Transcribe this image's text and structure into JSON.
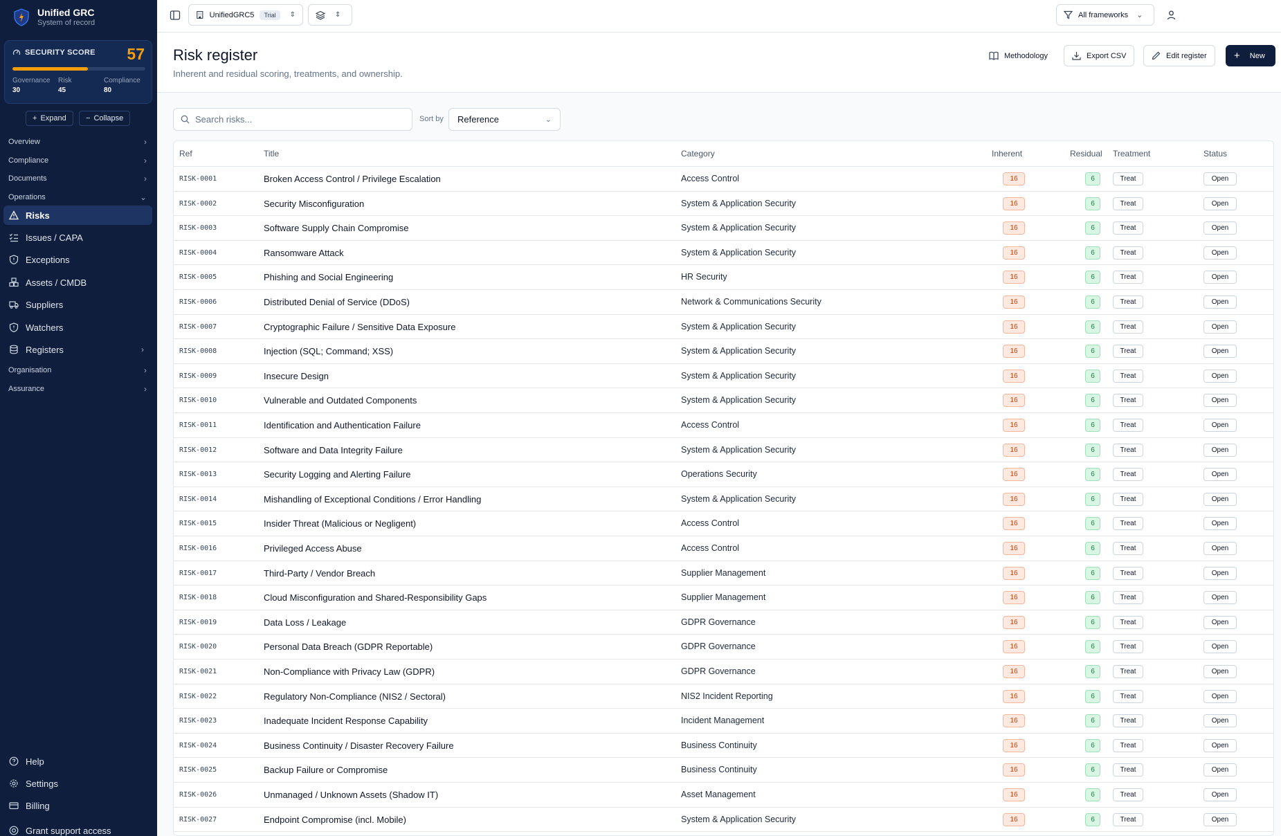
{
  "brand": {
    "name": "Unified GRC",
    "subtitle": "System of record"
  },
  "score": {
    "label": "SECURITY SCORE",
    "value": "57",
    "fill": 0.57,
    "metrics": [
      {
        "label": "Governance",
        "value": "30"
      },
      {
        "label": "Risk",
        "value": "45"
      },
      {
        "label": "Compliance",
        "value": "80"
      }
    ]
  },
  "tree_controls": {
    "expand": "Expand",
    "collapse": "Collapse"
  },
  "nav": {
    "sections": [
      "Overview",
      "Compliance",
      "Documents",
      "Operations"
    ],
    "items": [
      {
        "label": "Risks",
        "icon": "warning-icon"
      },
      {
        "label": "Issues / CAPA",
        "icon": "list-check-icon"
      },
      {
        "label": "Exceptions",
        "icon": "shield-icon"
      },
      {
        "label": "Assets / CMDB",
        "icon": "boxes-icon"
      },
      {
        "label": "Suppliers",
        "icon": "truck-icon"
      },
      {
        "label": "Watchers",
        "icon": "shield-icon"
      },
      {
        "label": "Registers",
        "icon": "database-icon"
      }
    ],
    "sections_after": [
      "Organisation",
      "Assurance"
    ],
    "bottom": [
      {
        "label": "Help",
        "icon": "help-icon"
      },
      {
        "label": "Settings",
        "icon": "gear-icon"
      },
      {
        "label": "Billing",
        "icon": "card-icon"
      },
      {
        "label": "Grant support access",
        "icon": "lifebuoy-icon"
      }
    ]
  },
  "topbar": {
    "org": "UnifiedGRC5",
    "org_badge": "Trial",
    "frameworks": "All frameworks"
  },
  "page": {
    "title": "Risk register",
    "subtitle": "Inherent and residual scoring, treatments, and ownership.",
    "actions": {
      "methodology": "Methodology",
      "export": "Export CSV",
      "edit": "Edit register",
      "new": "New"
    }
  },
  "controls": {
    "search_placeholder": "Search risks...",
    "sort_label": "Sort by",
    "sort_value": "Reference"
  },
  "table": {
    "columns": [
      "Ref",
      "Title",
      "Category",
      "Inherent",
      "Residual",
      "Treatment",
      "Status"
    ],
    "rows": [
      {
        "ref": "RISK-0001",
        "title": "Broken Access Control / Privilege Escalation",
        "category": "Access Control",
        "inherent": "16",
        "residual": "6",
        "treatment": "Treat",
        "status": "Open"
      },
      {
        "ref": "RISK-0002",
        "title": "Security Misconfiguration",
        "category": "System & Application Security",
        "inherent": "16",
        "residual": "6",
        "treatment": "Treat",
        "status": "Open"
      },
      {
        "ref": "RISK-0003",
        "title": "Software Supply Chain Compromise",
        "category": "System & Application Security",
        "inherent": "16",
        "residual": "6",
        "treatment": "Treat",
        "status": "Open"
      },
      {
        "ref": "RISK-0004",
        "title": "Ransomware Attack",
        "category": "System & Application Security",
        "inherent": "16",
        "residual": "6",
        "treatment": "Treat",
        "status": "Open"
      },
      {
        "ref": "RISK-0005",
        "title": "Phishing and Social Engineering",
        "category": "HR Security",
        "inherent": "16",
        "residual": "6",
        "treatment": "Treat",
        "status": "Open"
      },
      {
        "ref": "RISK-0006",
        "title": "Distributed Denial of Service (DDoS)",
        "category": "Network & Communications Security",
        "inherent": "16",
        "residual": "6",
        "treatment": "Treat",
        "status": "Open"
      },
      {
        "ref": "RISK-0007",
        "title": "Cryptographic Failure / Sensitive Data Exposure",
        "category": "System & Application Security",
        "inherent": "16",
        "residual": "6",
        "treatment": "Treat",
        "status": "Open"
      },
      {
        "ref": "RISK-0008",
        "title": "Injection (SQL; Command; XSS)",
        "category": "System & Application Security",
        "inherent": "16",
        "residual": "6",
        "treatment": "Treat",
        "status": "Open"
      },
      {
        "ref": "RISK-0009",
        "title": "Insecure Design",
        "category": "System & Application Security",
        "inherent": "16",
        "residual": "6",
        "treatment": "Treat",
        "status": "Open"
      },
      {
        "ref": "RISK-0010",
        "title": "Vulnerable and Outdated Components",
        "category": "System & Application Security",
        "inherent": "16",
        "residual": "6",
        "treatment": "Treat",
        "status": "Open"
      },
      {
        "ref": "RISK-0011",
        "title": "Identification and Authentication Failure",
        "category": "Access Control",
        "inherent": "16",
        "residual": "6",
        "treatment": "Treat",
        "status": "Open"
      },
      {
        "ref": "RISK-0012",
        "title": "Software and Data Integrity Failure",
        "category": "System & Application Security",
        "inherent": "16",
        "residual": "6",
        "treatment": "Treat",
        "status": "Open"
      },
      {
        "ref": "RISK-0013",
        "title": "Security Logging and Alerting Failure",
        "category": "Operations Security",
        "inherent": "16",
        "residual": "6",
        "treatment": "Treat",
        "status": "Open"
      },
      {
        "ref": "RISK-0014",
        "title": "Mishandling of Exceptional Conditions / Error Handling",
        "category": "System & Application Security",
        "inherent": "16",
        "residual": "6",
        "treatment": "Treat",
        "status": "Open"
      },
      {
        "ref": "RISK-0015",
        "title": "Insider Threat (Malicious or Negligent)",
        "category": "Access Control",
        "inherent": "16",
        "residual": "6",
        "treatment": "Treat",
        "status": "Open"
      },
      {
        "ref": "RISK-0016",
        "title": "Privileged Access Abuse",
        "category": "Access Control",
        "inherent": "16",
        "residual": "6",
        "treatment": "Treat",
        "status": "Open"
      },
      {
        "ref": "RISK-0017",
        "title": "Third-Party / Vendor Breach",
        "category": "Supplier Management",
        "inherent": "16",
        "residual": "6",
        "treatment": "Treat",
        "status": "Open"
      },
      {
        "ref": "RISK-0018",
        "title": "Cloud Misconfiguration and Shared-Responsibility Gaps",
        "category": "Supplier Management",
        "inherent": "16",
        "residual": "6",
        "treatment": "Treat",
        "status": "Open"
      },
      {
        "ref": "RISK-0019",
        "title": "Data Loss / Leakage",
        "category": "GDPR Governance",
        "inherent": "16",
        "residual": "6",
        "treatment": "Treat",
        "status": "Open"
      },
      {
        "ref": "RISK-0020",
        "title": "Personal Data Breach (GDPR Reportable)",
        "category": "GDPR Governance",
        "inherent": "16",
        "residual": "6",
        "treatment": "Treat",
        "status": "Open"
      },
      {
        "ref": "RISK-0021",
        "title": "Non-Compliance with Privacy Law (GDPR)",
        "category": "GDPR Governance",
        "inherent": "16",
        "residual": "6",
        "treatment": "Treat",
        "status": "Open"
      },
      {
        "ref": "RISK-0022",
        "title": "Regulatory Non-Compliance (NIS2 / Sectoral)",
        "category": "NIS2 Incident Reporting",
        "inherent": "16",
        "residual": "6",
        "treatment": "Treat",
        "status": "Open"
      },
      {
        "ref": "RISK-0023",
        "title": "Inadequate Incident Response Capability",
        "category": "Incident Management",
        "inherent": "16",
        "residual": "6",
        "treatment": "Treat",
        "status": "Open"
      },
      {
        "ref": "RISK-0024",
        "title": "Business Continuity / Disaster Recovery Failure",
        "category": "Business Continuity",
        "inherent": "16",
        "residual": "6",
        "treatment": "Treat",
        "status": "Open"
      },
      {
        "ref": "RISK-0025",
        "title": "Backup Failure or Compromise",
        "category": "Business Continuity",
        "inherent": "16",
        "residual": "6",
        "treatment": "Treat",
        "status": "Open"
      },
      {
        "ref": "RISK-0026",
        "title": "Unmanaged / Unknown Assets (Shadow IT)",
        "category": "Asset Management",
        "inherent": "16",
        "residual": "6",
        "treatment": "Treat",
        "status": "Open"
      },
      {
        "ref": "RISK-0027",
        "title": "Endpoint Compromise (incl. Mobile)",
        "category": "System & Application Security",
        "inherent": "16",
        "residual": "6",
        "treatment": "Treat",
        "status": "Open"
      }
    ]
  }
}
